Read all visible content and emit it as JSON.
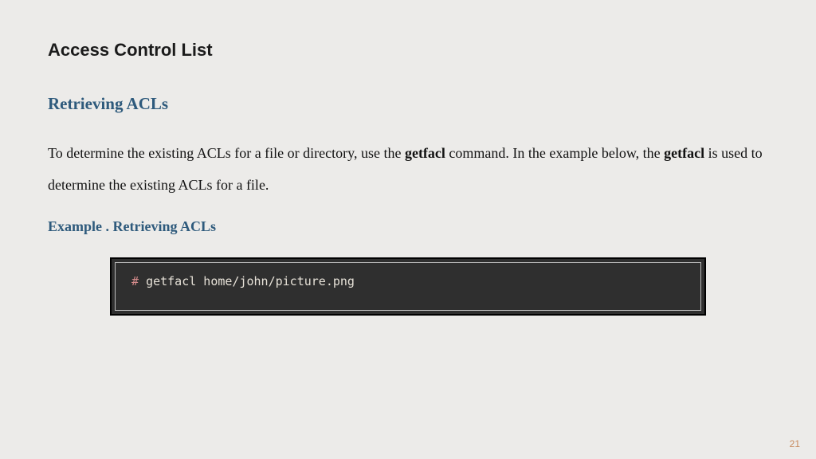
{
  "title": "Access Control List",
  "subheading": "Retrieving ACLs",
  "body": {
    "p1_a": "To determine the existing ACLs for a file or directory, use the ",
    "p1_cmd1": "getfacl",
    "p1_b": " command. In the example below, the ",
    "p1_cmd2": "getfacl",
    "p1_c": " is used to determine the existing ACLs for a file."
  },
  "example_label": "Example . Retrieving ACLs",
  "code": {
    "prompt": "# ",
    "command": "getfacl home/john/picture.png"
  },
  "page_number": "21"
}
